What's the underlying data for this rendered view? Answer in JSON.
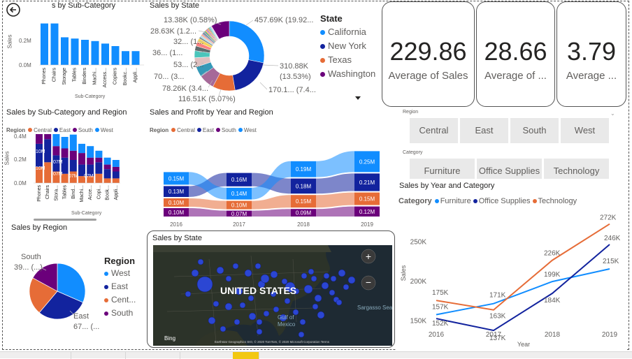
{
  "back_icon": "back-arrow-icon",
  "v1": {
    "title": "s by Sub-Category",
    "ylabel": "Sales",
    "ticks": [
      "0.2M",
      "0.0M"
    ],
    "xlabel": "Sub-Category",
    "chart_data": {
      "type": "bar",
      "categories": [
        "Phones",
        "Chairs",
        "Storage",
        "Tables",
        "Binders",
        "Machi...",
        "Access...",
        "Copiers",
        "Bookc...",
        "Appli..."
      ],
      "values": [
        0.33,
        0.33,
        0.22,
        0.21,
        0.2,
        0.19,
        0.17,
        0.15,
        0.11,
        0.11
      ],
      "ylabel": "Sales",
      "xlabel": "Sub-Category"
    }
  },
  "v2": {
    "title": "Sales by State",
    "legend_title": "State",
    "legend": [
      {
        "name": "California",
        "color": "#118dff"
      },
      {
        "name": "New York",
        "color": "#12239e"
      },
      {
        "name": "Texas",
        "color": "#e66c37"
      },
      {
        "name": "Washington",
        "color": "#6b007b"
      }
    ],
    "labels": [
      "13.38K (0.58%)",
      "28.63K (1.2...",
      "32... (1...",
      "36... (1...",
      "53... (2...",
      "70... (3...",
      "78.26K (3.4...",
      "116.51K (5.07%)",
      "457.69K (19.92...",
      "310.88K",
      "(13.53%)",
      "170.1... (7.4..."
    ],
    "chart_data": {
      "type": "pie",
      "labels": [
        "California",
        "New York",
        "Texas",
        "Washington"
      ],
      "values": [
        457.69,
        310.88,
        170.1,
        138.64
      ]
    }
  },
  "cards": [
    {
      "value": "229.86",
      "label": "Average of Sales"
    },
    {
      "value": "28.66",
      "label": "Average of ..."
    },
    {
      "value": "3.79",
      "label": "Average ..."
    }
  ],
  "v3": {
    "title": "Sales by Sub-Category and Region",
    "legend_label": "Region",
    "legend": [
      {
        "name": "Central",
        "color": "#e66c37"
      },
      {
        "name": "East",
        "color": "#12239e"
      },
      {
        "name": "South",
        "color": "#6b007b"
      },
      {
        "name": "West",
        "color": "#118dff"
      }
    ],
    "ticks": [
      "0.4M",
      "0.2M",
      "0.0M"
    ],
    "ylabel": "Sales",
    "xlabel": "Sub-Category",
    "seg_labels": [
      "10M",
      "10M",
      "07M",
      "07M",
      "07M",
      "07M"
    ],
    "chart_data": {
      "type": "bar",
      "categories": [
        "Phones",
        "Chairs",
        "Stora...",
        "Tables",
        "Bind...",
        "Machi...",
        "Acce...",
        "Copi...",
        "Book...",
        "Appli..."
      ],
      "series": [
        {
          "name": "Central",
          "values": [
            0.07,
            0.09,
            0.05,
            0.04,
            0.05,
            0.03,
            0.03,
            0.04,
            0.02,
            0.02
          ]
        },
        {
          "name": "East",
          "values": [
            0.1,
            0.1,
            0.07,
            0.07,
            0.05,
            0.05,
            0.05,
            0.05,
            0.04,
            0.03
          ]
        },
        {
          "name": "South",
          "values": [
            0.06,
            0.05,
            0.04,
            0.04,
            0.04,
            0.05,
            0.03,
            0.02,
            0.02,
            0.02
          ]
        },
        {
          "name": "West",
          "values": [
            0.1,
            0.1,
            0.07,
            0.05,
            0.07,
            0.04,
            0.05,
            0.03,
            0.03,
            0.03
          ]
        }
      ]
    }
  },
  "v4": {
    "title": "Sales and Profit by Year and Region",
    "legend_label": "Region",
    "legend": [
      {
        "name": "Central",
        "color": "#e66c37"
      },
      {
        "name": "East",
        "color": "#12239e"
      },
      {
        "name": "South",
        "color": "#6b007b"
      },
      {
        "name": "West",
        "color": "#118dff"
      }
    ],
    "chart_data": {
      "type": "area",
      "x": [
        "2016",
        "2017",
        "2018",
        "2019"
      ],
      "series": [
        {
          "name": "Central",
          "values": [
            "0.10M",
            "0.10M",
            "0.15M",
            "0.15M"
          ]
        },
        {
          "name": "East",
          "values": [
            "0.13M",
            "0.16M",
            "0.18M",
            "0.21M"
          ]
        },
        {
          "name": "South",
          "values": [
            "0.10M",
            "0.07M",
            "0.09M",
            "0.12M"
          ]
        },
        {
          "name": "West",
          "values": [
            "0.15M",
            "0.14M",
            "0.19M",
            "0.25M"
          ]
        }
      ]
    }
  },
  "slicer_region": {
    "label": "Region",
    "options": [
      "Central",
      "East",
      "South",
      "West"
    ]
  },
  "slicer_category": {
    "label": "Category",
    "options": [
      "Furniture",
      "Office Supplies",
      "Technology"
    ]
  },
  "v5": {
    "title": "Sales by Year and Category",
    "legend_label": "Category",
    "legend": [
      {
        "name": "Furniture",
        "color": "#118dff"
      },
      {
        "name": "Office Supplies",
        "color": "#12239e"
      },
      {
        "name": "Technology",
        "color": "#e66c37"
      }
    ],
    "yticks": [
      "250K",
      "200K",
      "150K"
    ],
    "ylabel": "Sales",
    "xlabel": "Year",
    "chart_data": {
      "type": "line",
      "x": [
        "2016",
        "2017",
        "2018",
        "2019"
      ],
      "ylim": [
        130,
        285
      ],
      "series": [
        {
          "name": "Furniture",
          "values": [
            157,
            171,
            199,
            215
          ],
          "labels": [
            "157K",
            "171K",
            "199K",
            "215K"
          ]
        },
        {
          "name": "Office Supplies",
          "values": [
            152,
            137,
            184,
            246
          ],
          "labels": [
            "152K",
            "137K",
            "184K",
            "246K"
          ]
        },
        {
          "name": "Technology",
          "values": [
            175,
            163,
            226,
            272
          ],
          "labels": [
            "175K",
            "163K",
            "226K",
            "272K"
          ]
        }
      ]
    }
  },
  "v6": {
    "title": "Sales by Region",
    "legend_title": "Region",
    "legend": [
      {
        "name": "West",
        "color": "#118dff"
      },
      {
        "name": "East",
        "color": "#12239e"
      },
      {
        "name": "Cent...",
        "color": "#e66c37"
      },
      {
        "name": "South",
        "color": "#6b007b"
      }
    ],
    "label_south_1": "South",
    "label_south_2": "39... (...)",
    "label_east_1": "East",
    "label_east_2": "67... (...",
    "chart_data": {
      "type": "pie",
      "labels": [
        "West",
        "East",
        "Central",
        "South"
      ],
      "values": [
        725.46,
        678.78,
        501.24,
        391.72
      ]
    }
  },
  "v7": {
    "title": "Sales by State",
    "country_label": "UNITED STATES",
    "gulf_1": "Gulf of",
    "gulf_2": "Mexico",
    "sea_label": "Sargasso Sea",
    "bing": "Bing",
    "attribution": "Earthstar Geographics SIO, © 2020 TomTom, © 2020 Microsoft Corporation  Terms",
    "zoom_in": "+",
    "zoom_out": "−"
  }
}
